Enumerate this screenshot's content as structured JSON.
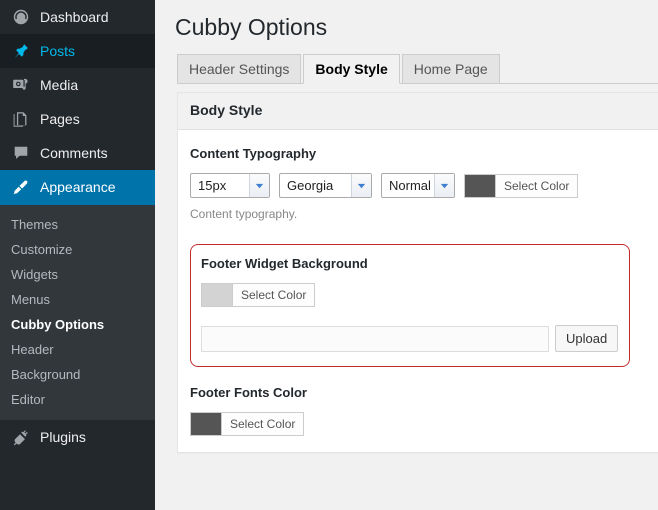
{
  "sidebar": {
    "top_items": [
      {
        "label": "Dashboard",
        "icon": "dashboard-icon",
        "state": "normal"
      },
      {
        "label": "Posts",
        "icon": "pin-icon",
        "state": "hover"
      },
      {
        "label": "Media",
        "icon": "media-icon",
        "state": "normal"
      },
      {
        "label": "Pages",
        "icon": "pages-icon",
        "state": "normal"
      },
      {
        "label": "Comments",
        "icon": "comment-icon",
        "state": "normal"
      },
      {
        "label": "Appearance",
        "icon": "paintbrush-icon",
        "state": "current"
      }
    ],
    "submenu": [
      {
        "label": "Themes",
        "current": false
      },
      {
        "label": "Customize",
        "current": false
      },
      {
        "label": "Widgets",
        "current": false
      },
      {
        "label": "Menus",
        "current": false
      },
      {
        "label": "Cubby Options",
        "current": true
      },
      {
        "label": "Header",
        "current": false
      },
      {
        "label": "Background",
        "current": false
      },
      {
        "label": "Editor",
        "current": false
      }
    ],
    "bottom_items": [
      {
        "label": "Plugins",
        "icon": "plug-icon"
      }
    ]
  },
  "page": {
    "title": "Cubby Options"
  },
  "tabs": [
    {
      "label": "Header Settings",
      "active": false
    },
    {
      "label": "Body Style",
      "active": true
    },
    {
      "label": "Home Page",
      "active": false
    }
  ],
  "panel": {
    "heading": "Body Style"
  },
  "content_typography": {
    "label": "Content Typography",
    "size": "15px",
    "family": "Georgia",
    "weight": "Normal",
    "color_button_label": "Select Color",
    "color_swatch": "#555555",
    "description": "Content typography."
  },
  "footer_widget_background": {
    "label": "Footer Widget Background",
    "color_button_label": "Select Color",
    "color_swatch": "#d3d3d3",
    "upload_value": "",
    "upload_placeholder": "",
    "upload_button_label": "Upload",
    "highlight_color": "#c32b2b"
  },
  "footer_fonts_color": {
    "label": "Footer Fonts Color",
    "color_button_label": "Select Color",
    "color_swatch": "#555555"
  },
  "colors": {
    "admin_bg": "#23282d",
    "submenu_bg": "#32373c",
    "accent_blue": "#0073aa",
    "hover_blue": "#00b9eb",
    "content_bg": "#f1f1f1"
  }
}
